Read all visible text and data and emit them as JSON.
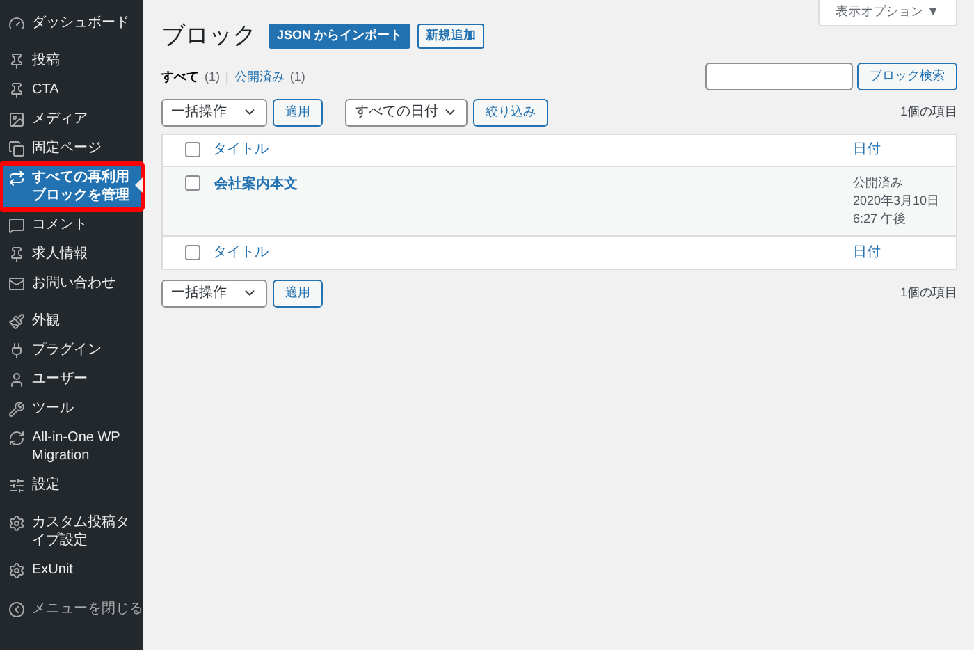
{
  "sidebar": {
    "groups": [
      [
        {
          "label": "ダッシュボード",
          "selected": false,
          "highlighted": false
        }
      ],
      [
        {
          "label": "投稿",
          "selected": false,
          "highlighted": false
        },
        {
          "label": "CTA",
          "selected": false,
          "highlighted": false
        },
        {
          "label": "メディア",
          "selected": false,
          "highlighted": false
        },
        {
          "label": "固定ページ",
          "selected": false,
          "highlighted": false
        },
        {
          "label": "すべての再利用ブロックを管理",
          "selected": true,
          "highlighted": true
        },
        {
          "label": "コメント",
          "selected": false,
          "highlighted": false
        },
        {
          "label": "求人情報",
          "selected": false,
          "highlighted": false
        },
        {
          "label": "お問い合わせ",
          "selected": false,
          "highlighted": false
        }
      ],
      [
        {
          "label": "外観",
          "selected": false,
          "highlighted": false
        },
        {
          "label": "プラグイン",
          "selected": false,
          "highlighted": false
        },
        {
          "label": "ユーザー",
          "selected": false,
          "highlighted": false
        },
        {
          "label": "ツール",
          "selected": false,
          "highlighted": false
        },
        {
          "label": "All-in-One WP Migration",
          "selected": false,
          "highlighted": false
        },
        {
          "label": "設定",
          "selected": false,
          "highlighted": false
        }
      ],
      [
        {
          "label": "カスタム投稿タイプ設定",
          "selected": false,
          "highlighted": false
        },
        {
          "label": "ExUnit",
          "selected": false,
          "highlighted": false
        }
      ]
    ],
    "collapse_label": "メニューを閉じる"
  },
  "screen_options": "表示オプション ▼",
  "page_title": "ブロック",
  "title_buttons": [
    {
      "label": "JSON からインポート",
      "kind": "primary"
    },
    {
      "label": "新規追加",
      "kind": "secondary"
    }
  ],
  "view_separator": "|",
  "views": [
    {
      "label": "すべて",
      "count": "(1)",
      "selected": true
    },
    {
      "label": "公開済み",
      "count": "(1)",
      "selected": false
    }
  ],
  "search": {
    "button": "ブロック検索"
  },
  "top_nav": {
    "bulk_action": "一括操作",
    "apply": "適用",
    "date_filter": "すべての日付",
    "filter": "絞り込み",
    "count": "1個の項目"
  },
  "table": {
    "header_checked": false,
    "footer_checked": false,
    "columns": [
      "タイトル",
      "日付"
    ],
    "rows": [
      {
        "checked": false,
        "title": "会社案内本文",
        "date_lines": [
          "公開済み",
          "2020年3月10日",
          "6:27 午後"
        ]
      }
    ],
    "footer_columns": [
      "タイトル",
      "日付"
    ]
  },
  "bottom_nav": {
    "bulk_action": "一括操作",
    "apply": "適用",
    "count": "1個の項目"
  }
}
